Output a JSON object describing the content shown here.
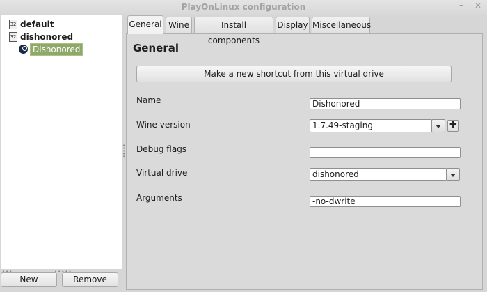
{
  "window": {
    "title": "PlayOnLinux configuration",
    "minimize_glyph": "–",
    "close_glyph": "✕"
  },
  "tree": {
    "items": [
      {
        "label": "default",
        "icon": "32",
        "icon_name": "wine-32bit-icon"
      },
      {
        "label": "dishonored",
        "icon": "32",
        "icon_name": "wine-32bit-icon"
      }
    ],
    "child": {
      "label": "Dishonored",
      "icon_name": "steam-icon",
      "selected": true
    }
  },
  "buttons": {
    "new": "New",
    "remove": "Remove"
  },
  "tabs": [
    {
      "label": "General",
      "active": true
    },
    {
      "label": "Wine",
      "active": false
    },
    {
      "label": "Install components",
      "active": false
    },
    {
      "label": "Display",
      "active": false
    },
    {
      "label": "Miscellaneous",
      "active": false
    }
  ],
  "general": {
    "heading": "General",
    "shortcut_button": "Make a new shortcut from this virtual drive",
    "fields": {
      "name": {
        "label": "Name",
        "value": "Dishonored"
      },
      "wine_version": {
        "label": "Wine version",
        "value": "1.7.49-staging",
        "add_glyph": "✚"
      },
      "debug_flags": {
        "label": "Debug flags",
        "value": ""
      },
      "virtual_drive": {
        "label": "Virtual drive",
        "value": "dishonored"
      },
      "arguments": {
        "label": "Arguments",
        "value": "-no-dwrite"
      }
    }
  },
  "colors": {
    "selection": "#8ea86a",
    "background": "#d6d6d6"
  }
}
